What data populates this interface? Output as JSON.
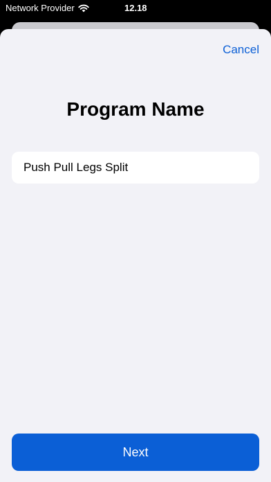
{
  "status_bar": {
    "carrier": "Network Provider",
    "time": "12.18",
    "wifi_icon": "wifi-icon"
  },
  "sheet": {
    "cancel_label": "Cancel",
    "title": "Program Name",
    "name_input_value": "Push Pull Legs Split",
    "next_label": "Next"
  },
  "colors": {
    "accent": "#0b5fd6",
    "sheet_background": "#f2f2f7",
    "status_bar_background": "#000000"
  }
}
